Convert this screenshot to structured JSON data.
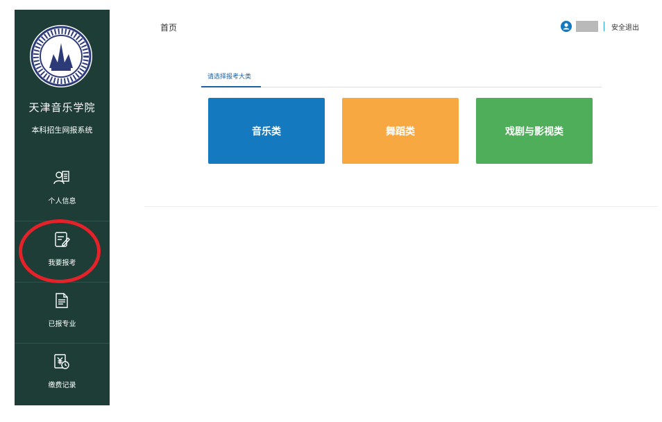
{
  "sidebar": {
    "school_name": "天津音乐学院",
    "system_name": "本科招生网报系统",
    "logo_name": "tianjin-conservatory-seal",
    "items": [
      {
        "label": "个人信息",
        "icon": "user-card-icon"
      },
      {
        "label": "我要报考",
        "icon": "edit-form-icon"
      },
      {
        "label": "已报专业",
        "icon": "document-list-icon"
      },
      {
        "label": "缴费记录",
        "icon": "payment-record-icon"
      }
    ]
  },
  "header": {
    "breadcrumb": "首页",
    "logout_label": "安全退出"
  },
  "main": {
    "tab_label": "请选择报考大类",
    "categories": [
      {
        "label": "音乐类",
        "color": "#1479bf"
      },
      {
        "label": "舞蹈类",
        "color": "#f7a840"
      },
      {
        "label": "戏剧与影视类",
        "color": "#4fae5a"
      }
    ]
  },
  "colors": {
    "sidebar_bg": "#1d3d36",
    "accent": "#1a61a3",
    "highlight_circle": "#e5212a"
  }
}
